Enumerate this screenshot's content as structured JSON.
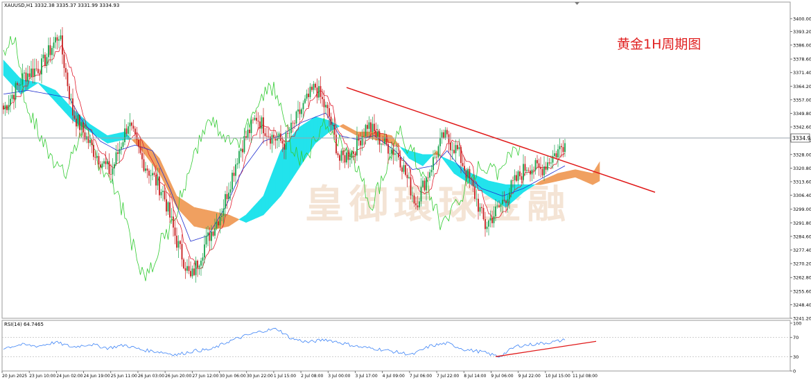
{
  "header": {
    "symbol_info": "XAUUSD,H1  3332.38 3335.37 3331.99 3334.93"
  },
  "title": "黄金1H周期图",
  "watermark": "皇御環球金融",
  "current_price_label": "3334.93",
  "rsi_label": "RSI(14) 64.7465",
  "colors": {
    "bull": "#16a34a",
    "bear": "#c81e1e",
    "tenkan": "#e11d2e",
    "kijun": "#1f2fd0",
    "chikou": "#33cc33",
    "cloud_bull": "#22e3ec",
    "cloud_bear": "#f0a060",
    "trendline": "#e01818",
    "rsi_line": "#3b82f6"
  },
  "chart_data": [
    {
      "type": "candlestick",
      "name": "XAUUSD,H1",
      "ylim": [
        3241.2,
        3404.0
      ],
      "yticks": [
        3400.0,
        3393.2,
        3386.0,
        3378.6,
        3371.4,
        3364.2,
        3357.0,
        3349.8,
        3342.6,
        3335.4,
        3328.0,
        3320.8,
        3313.6,
        3306.4,
        3299.0,
        3291.8,
        3284.6,
        3277.4,
        3270.2,
        3262.8,
        3255.6,
        3248.4,
        3241.2
      ],
      "xticks": [
        "20 Jun 2025",
        "23 Jun 10:00",
        "24 Jun 02:00",
        "24 Jun 19:00",
        "25 Jun 11:00",
        "26 Jun 03:00",
        "26 Jun 20:00",
        "27 Jun 12:00",
        "30 Jun 06:00",
        "30 Jun 22:00",
        "1 Jul 15:00",
        "2 Jul 08:00",
        "3 Jul 00:00",
        "3 Jul 17:00",
        "4 Jul 09:00",
        "7 Jul 06:00",
        "7 Jul 22:00",
        "8 Jul 14:00",
        "9 Jul 06:00",
        "9 Jul 22:00",
        "10 Jul 15:00",
        "11 Jul 08:00"
      ],
      "anchors": [
        [
          0,
          3352
        ],
        [
          12,
          3370
        ],
        [
          22,
          3375
        ],
        [
          32,
          3392
        ],
        [
          40,
          3350
        ],
        [
          52,
          3330
        ],
        [
          62,
          3318
        ],
        [
          72,
          3345
        ],
        [
          80,
          3325
        ],
        [
          92,
          3308
        ],
        [
          100,
          3282
        ],
        [
          108,
          3262
        ],
        [
          116,
          3280
        ],
        [
          126,
          3298
        ],
        [
          136,
          3330
        ],
        [
          146,
          3348
        ],
        [
          154,
          3338
        ],
        [
          162,
          3334
        ],
        [
          172,
          3352
        ],
        [
          180,
          3364
        ],
        [
          188,
          3348
        ],
        [
          194,
          3325
        ],
        [
          202,
          3330
        ],
        [
          210,
          3344
        ],
        [
          218,
          3335
        ],
        [
          228,
          3328
        ],
        [
          238,
          3302
        ],
        [
          246,
          3320
        ],
        [
          254,
          3338
        ],
        [
          262,
          3330
        ],
        [
          270,
          3312
        ],
        [
          278,
          3290
        ],
        [
          286,
          3300
        ],
        [
          294,
          3312
        ],
        [
          302,
          3322
        ],
        [
          310,
          3320
        ],
        [
          318,
          3328
        ],
        [
          324,
          3334
        ]
      ],
      "kijun_anchors": [
        [
          0,
          3360
        ],
        [
          14,
          3362
        ],
        [
          26,
          3360
        ],
        [
          38,
          3358
        ],
        [
          46,
          3345
        ],
        [
          56,
          3335
        ],
        [
          66,
          3330
        ],
        [
          76,
          3333
        ],
        [
          86,
          3330
        ],
        [
          96,
          3310
        ],
        [
          108,
          3282
        ],
        [
          118,
          3285
        ],
        [
          128,
          3300
        ],
        [
          138,
          3320
        ],
        [
          150,
          3335
        ],
        [
          160,
          3338
        ],
        [
          172,
          3345
        ],
        [
          186,
          3350
        ],
        [
          194,
          3338
        ],
        [
          204,
          3336
        ],
        [
          214,
          3338
        ],
        [
          226,
          3330
        ],
        [
          236,
          3320
        ],
        [
          248,
          3322
        ],
        [
          256,
          3330
        ],
        [
          266,
          3318
        ],
        [
          276,
          3310
        ],
        [
          288,
          3306
        ],
        [
          300,
          3310
        ],
        [
          312,
          3316
        ],
        [
          324,
          3322
        ]
      ],
      "cloud_anchors": [
        [
          0,
          3378,
          3370
        ],
        [
          10,
          3368,
          3360
        ],
        [
          20,
          3366,
          3366
        ],
        [
          30,
          3362,
          3356
        ],
        [
          40,
          3352,
          3346
        ],
        [
          50,
          3344,
          3340
        ],
        [
          60,
          3338,
          3334
        ],
        [
          70,
          3340,
          3336
        ],
        [
          80,
          3330,
          3336
        ],
        [
          90,
          3318,
          3326
        ],
        [
          100,
          3300,
          3306
        ],
        [
          110,
          3290,
          3300
        ],
        [
          120,
          3288,
          3298
        ],
        [
          130,
          3290,
          3296
        ],
        [
          140,
          3296,
          3292
        ],
        [
          150,
          3306,
          3296
        ],
        [
          160,
          3330,
          3306
        ],
        [
          170,
          3342,
          3320
        ],
        [
          180,
          3348,
          3334
        ],
        [
          188,
          3346,
          3340
        ],
        [
          196,
          3342,
          3344
        ],
        [
          204,
          3338,
          3340
        ],
        [
          214,
          3336,
          3340
        ],
        [
          224,
          3334,
          3338
        ],
        [
          234,
          3330,
          3326
        ],
        [
          242,
          3328,
          3322
        ],
        [
          250,
          3328,
          3330
        ],
        [
          260,
          3324,
          3318
        ],
        [
          270,
          3318,
          3312
        ],
        [
          280,
          3314,
          3306
        ],
        [
          290,
          3312,
          3300
        ],
        [
          300,
          3312,
          3308
        ],
        [
          310,
          3312,
          3314
        ],
        [
          320,
          3314,
          3318
        ],
        [
          330,
          3316,
          3320
        ],
        [
          340,
          3312,
          3318
        ],
        [
          344,
          3314,
          3324
        ]
      ],
      "trendline": [
        [
          198,
          3363.5
        ],
        [
          376,
          3308
        ]
      ]
    },
    {
      "type": "line",
      "name": "RSI(14)",
      "ylim": [
        0,
        100
      ],
      "yticks": [
        100,
        70,
        30,
        0
      ],
      "levels": [
        70,
        30
      ],
      "anchors": [
        [
          0,
          48
        ],
        [
          10,
          55
        ],
        [
          20,
          52
        ],
        [
          30,
          60
        ],
        [
          40,
          50
        ],
        [
          50,
          56
        ],
        [
          60,
          48
        ],
        [
          70,
          54
        ],
        [
          80,
          44
        ],
        [
          90,
          40
        ],
        [
          100,
          34
        ],
        [
          110,
          42
        ],
        [
          120,
          45
        ],
        [
          130,
          62
        ],
        [
          140,
          74
        ],
        [
          150,
          84
        ],
        [
          158,
          88
        ],
        [
          166,
          68
        ],
        [
          176,
          60
        ],
        [
          186,
          66
        ],
        [
          196,
          58
        ],
        [
          206,
          50
        ],
        [
          216,
          46
        ],
        [
          226,
          40
        ],
        [
          236,
          34
        ],
        [
          246,
          52
        ],
        [
          256,
          58
        ],
        [
          266,
          45
        ],
        [
          276,
          40
        ],
        [
          286,
          30
        ],
        [
          296,
          52
        ],
        [
          306,
          56
        ],
        [
          316,
          60
        ],
        [
          324,
          64.7465
        ]
      ],
      "trendline": [
        [
          284,
          30
        ],
        [
          342,
          62
        ]
      ]
    }
  ]
}
